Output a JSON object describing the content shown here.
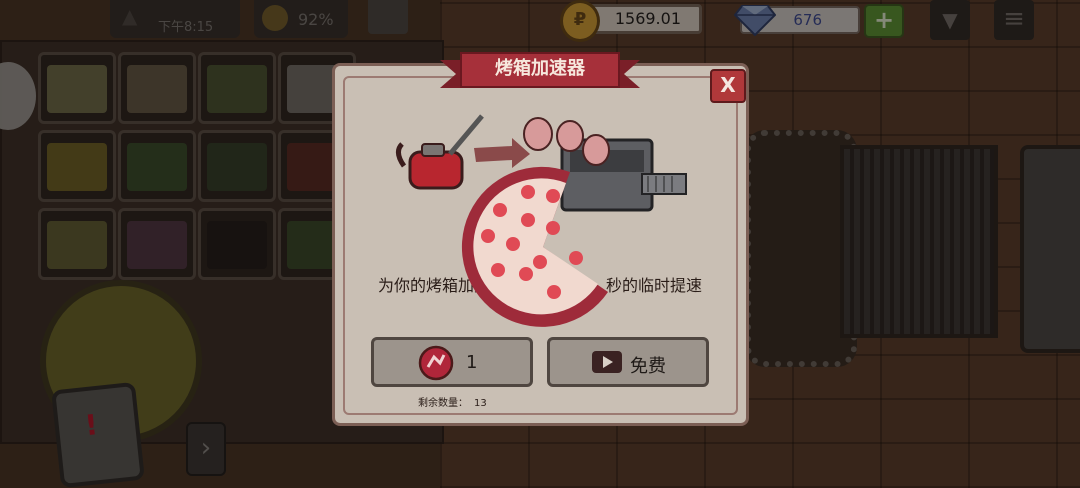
{
  "hud": {
    "clock": "下午8:15",
    "happiness": "92%",
    "coins": "1569.01",
    "gems": "676",
    "plus_label": "+"
  },
  "dialog": {
    "title": "烤箱加速器",
    "close_label": "X",
    "description_left": "为你的烤箱加点机油，",
    "description_right": "秒的临时提速",
    "buy_count": "1",
    "free_label": "免费",
    "remaining_label": "剩余数量：",
    "remaining_value": "13"
  },
  "icons": {
    "close": "close-icon",
    "booster": "booster-icon",
    "video": "video-icon",
    "coin": "coin-icon",
    "gem": "gem-icon",
    "menu": "menu-icon",
    "dropdown": "chevron-down-icon"
  },
  "colors": {
    "ribbon": "#a6303a",
    "close": "#b0383a",
    "plus": "#5e9a36",
    "pizza_crust": "#9e2b3a",
    "pepperoni": "#e04a55"
  }
}
